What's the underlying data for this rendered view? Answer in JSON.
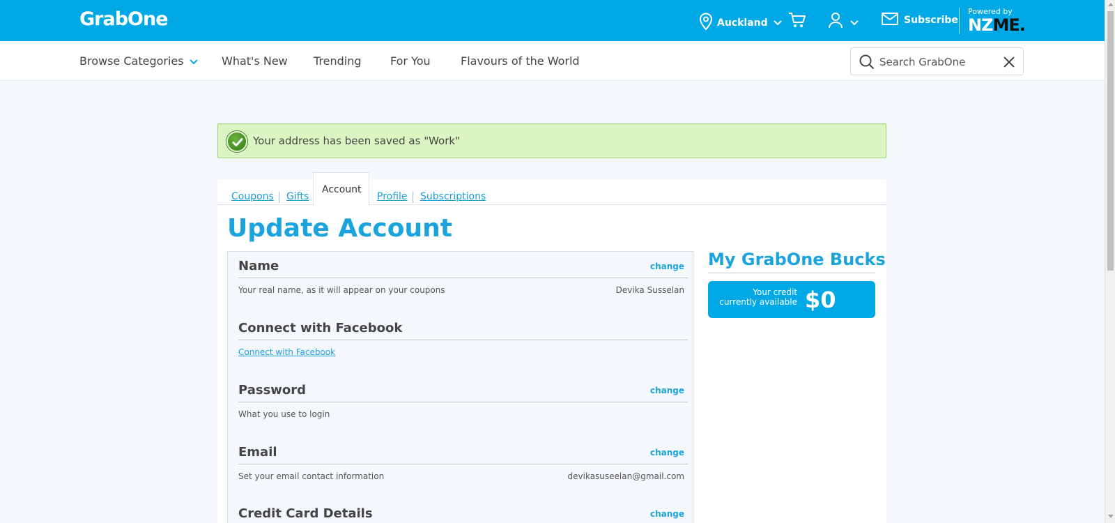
{
  "header": {
    "logo": "GrabOne",
    "location": "Auckland",
    "subscribe": "Subscribe",
    "powered_by": "Powered by",
    "nzme_nz": "NZ",
    "nzme_me": "ME."
  },
  "nav": {
    "items": [
      "Browse Categories",
      "What's New",
      "Trending",
      "For You",
      "Flavours of the World"
    ],
    "search_placeholder": "Search GrabOne"
  },
  "alert": {
    "message": "Your address has been saved as \"Work\""
  },
  "tabs": {
    "coupons": "Coupons",
    "gifts": "Gifts",
    "account": "Account",
    "profile": "Profile",
    "subscriptions": "Subscriptions"
  },
  "page_title": "Update Account",
  "sections": {
    "name": {
      "title": "Name",
      "change": "change",
      "desc": "Your real name, as it will appear on your coupons",
      "value": "Devika Susselan"
    },
    "facebook": {
      "title": "Connect with Facebook",
      "link": "Connect with Facebook"
    },
    "password": {
      "title": "Password",
      "change": "change",
      "desc": "What you use to login"
    },
    "email": {
      "title": "Email",
      "change": "change",
      "desc": "Set your email contact information",
      "value": "devikasuseelan@gmail.com"
    },
    "card": {
      "title": "Credit Card Details",
      "change": "change"
    }
  },
  "bucks": {
    "title": "My GrabOne Bucks",
    "label": "Your credit currently available",
    "amount": "$0"
  },
  "colors": {
    "brand": "#00a9e6",
    "accent_text": "#1aa3dc",
    "alert_bg": "#dbf5c2"
  }
}
